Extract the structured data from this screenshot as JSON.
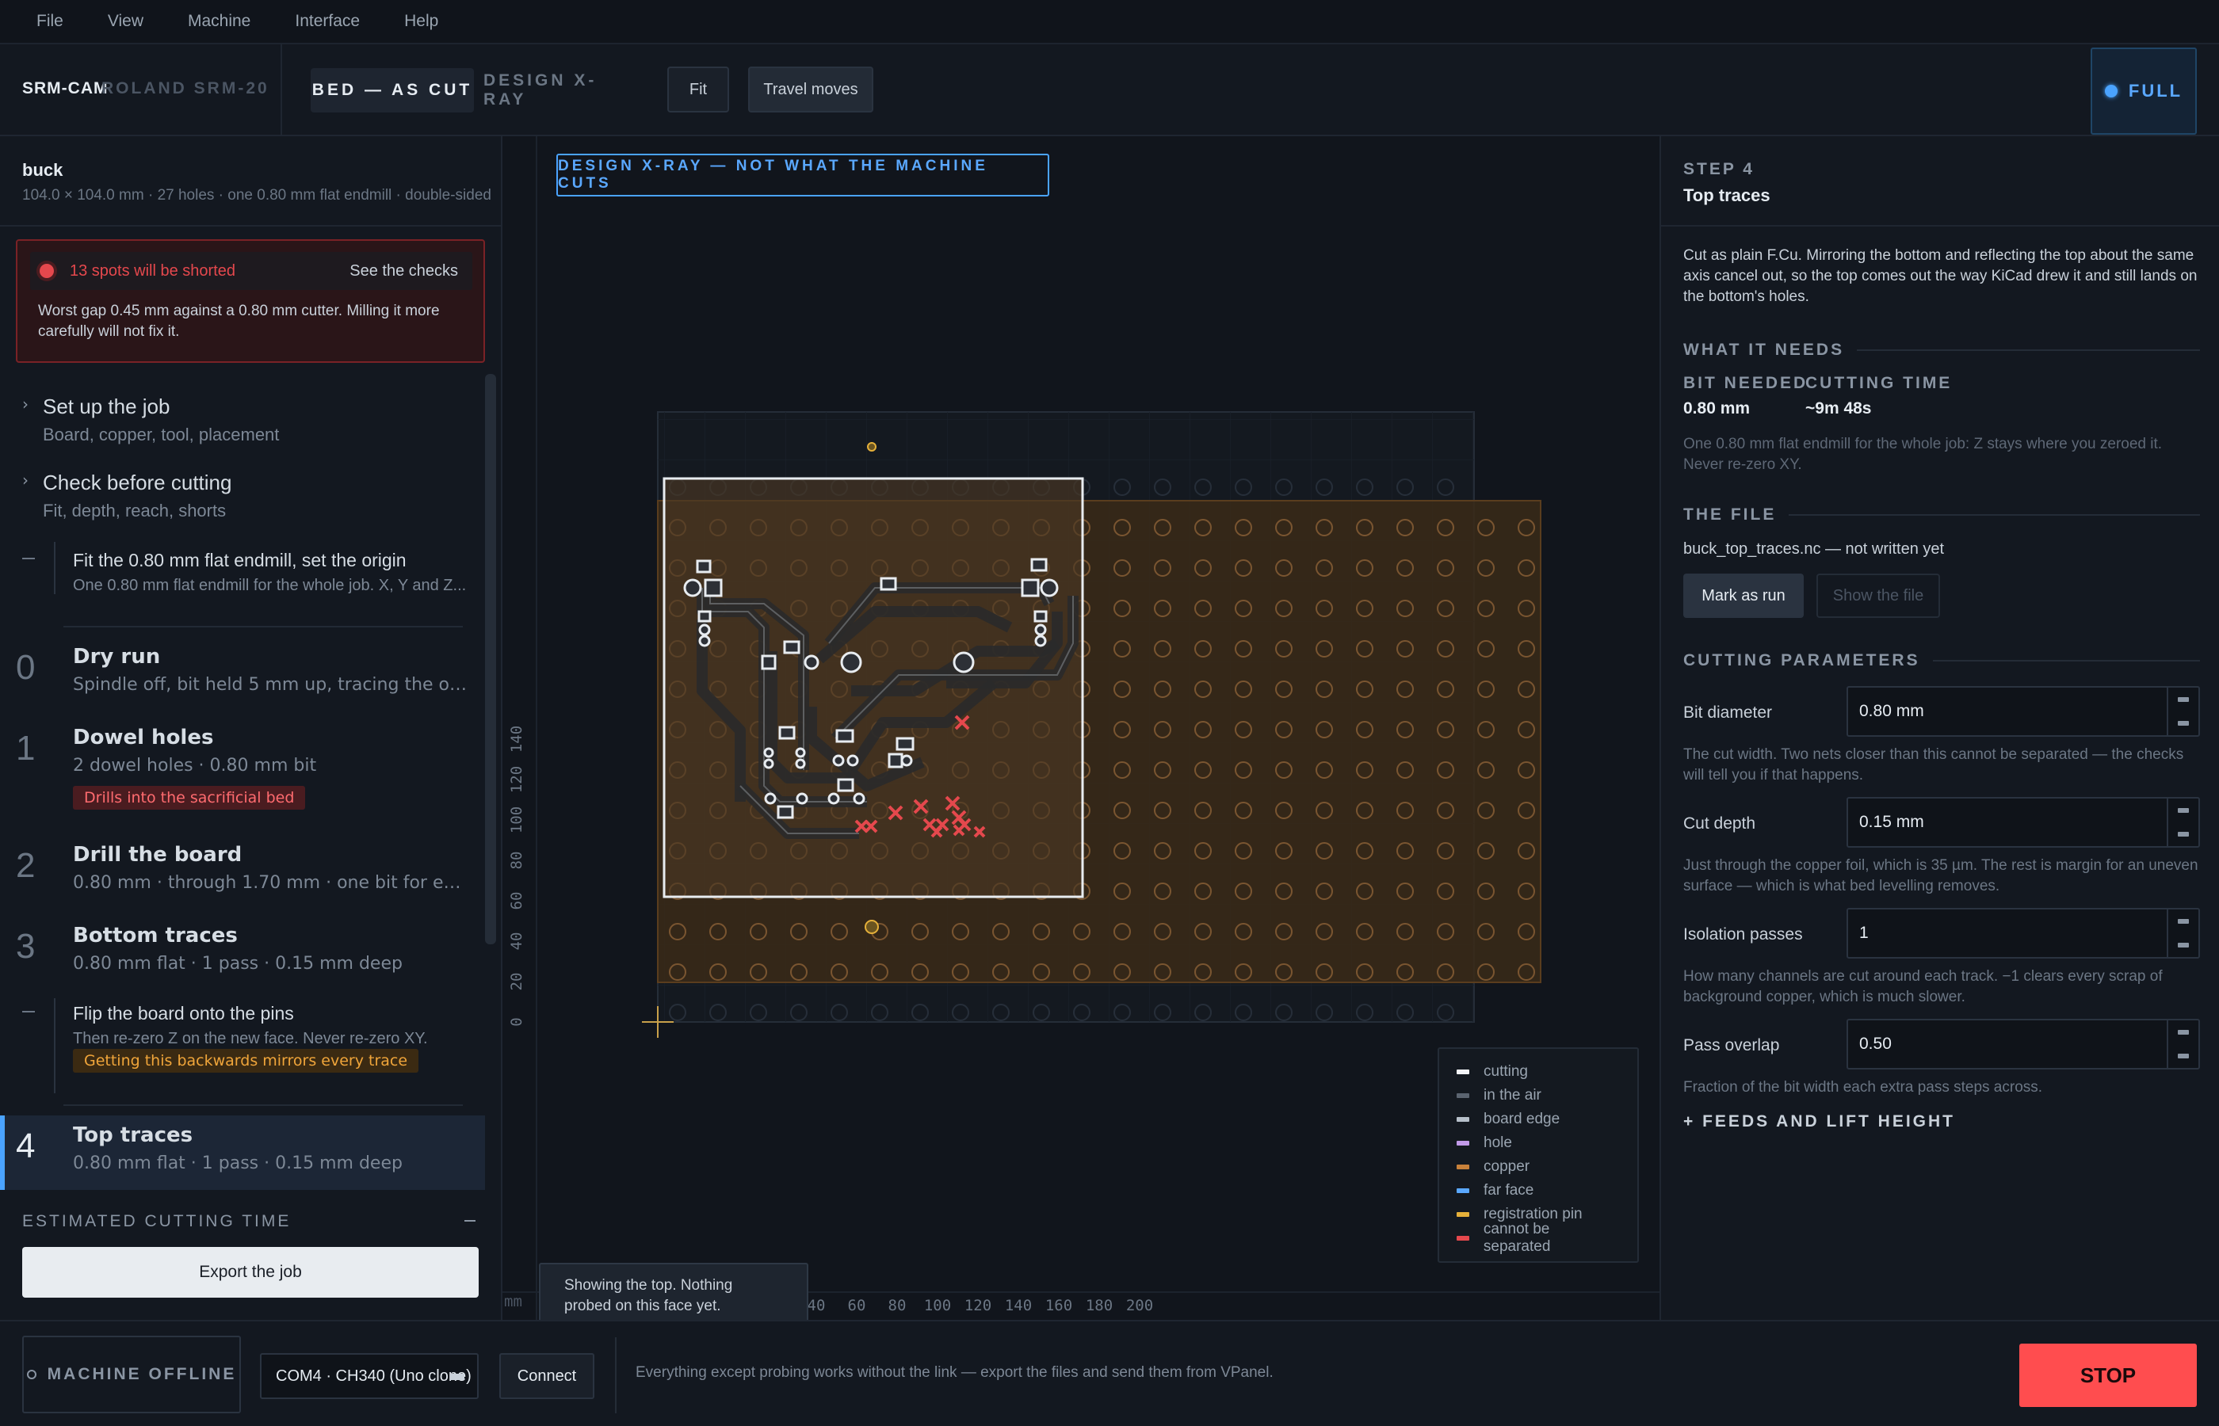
{
  "menu": [
    "File",
    "View",
    "Machine",
    "Interface",
    "Help"
  ],
  "toolbar": {
    "app_name": "SRM-CAM",
    "machine": "ROLAND SRM-20",
    "view_active": "BED — AS CUT",
    "view_inactive": "DESIGN X-RAY",
    "fit_label": "Fit",
    "travel_label": "Travel moves",
    "full_label": "FULL",
    "accent": "#4aa3ff"
  },
  "project": {
    "name": "buck",
    "meta": "104.0 × 104.0 mm · 27 holes · one 0.80 mm flat endmill · double-sided"
  },
  "alert": {
    "title": "13 spots will be shorted",
    "link": "See the checks",
    "body": "Worst gap 0.45 mm against a 0.80 mm cutter. Milling it more carefully will not fix it."
  },
  "stages": [
    {
      "title": "Set up the job",
      "sub": "Board, copper, tool, placement"
    },
    {
      "title": "Check before cutting",
      "sub": "Fit, depth, reach, shorts"
    }
  ],
  "origin_step": {
    "title": "Fit the 0.80 mm flat endmill, set the origin",
    "sub": "One 0.80 mm flat endmill for the whole job. X, Y and Z..."
  },
  "steps": [
    {
      "num": "0",
      "title": "Dry run",
      "sub": "Spindle off, bit held 5 mm up, tracing the out..."
    },
    {
      "num": "1",
      "title": "Dowel holes",
      "sub": "2 dowel holes · 0.80 mm bit",
      "tag": "Drills into the sacrificial bed"
    },
    {
      "num": "2",
      "title": "Drill the board",
      "sub": "0.80 mm · through 1.70 mm · one bit for every..."
    },
    {
      "num": "3",
      "title": "Bottom traces",
      "sub": "0.80 mm flat · 1 pass · 0.15 mm deep"
    },
    {
      "num": "4",
      "title": "Top traces",
      "sub": "0.80 mm flat · 1 pass · 0.15 mm deep"
    }
  ],
  "flip_step": {
    "title": "Flip the board onto the pins",
    "sub": "Then re-zero Z on the new face. Never re-zero XY.",
    "tag": "Getting this backwards mirrors every trace"
  },
  "estimate": {
    "title": "ESTIMATED CUTTING TIME",
    "export_label": "Export the job"
  },
  "canvas": {
    "xray_badge": "DESIGN X-RAY — NOT WHAT THE MACHINE CUTS",
    "units": "mm",
    "y_ticks": [
      "0",
      "20",
      "40",
      "60",
      "80",
      "100",
      "120",
      "140"
    ],
    "x_ticks": [
      "40",
      "60",
      "80",
      "100",
      "120",
      "140",
      "160",
      "180",
      "200"
    ],
    "tooltip": "Showing the top. Nothing probed on this face yet.",
    "legend": [
      {
        "label": "cutting",
        "color": "#f2f4f7"
      },
      {
        "label": "in the air",
        "color": "#5b6470"
      },
      {
        "label": "board edge",
        "color": "#b7c0ca"
      },
      {
        "label": "hole",
        "color": "#c29ae8"
      },
      {
        "label": "copper",
        "color": "#c8813a"
      },
      {
        "label": "far face",
        "color": "#5aa8ff"
      },
      {
        "label": "registration pin",
        "color": "#e5b03a"
      },
      {
        "label": "cannot be separated",
        "color": "#e5484d"
      }
    ]
  },
  "inspector": {
    "step_label": "STEP 4",
    "title": "Top traces",
    "desc": "Cut as plain F.Cu. Mirroring the bottom and reflecting the top about the same axis cancel out, so the top comes out the way KiCad drew it and still lands on the bottom's holes.",
    "needs_title": "WHAT IT NEEDS",
    "bit_key": "BIT NEEDED",
    "bit_val": "0.80 mm",
    "time_key": "CUTTING TIME",
    "time_val": "~9m 48s",
    "needs_note": "One 0.80 mm flat endmill for the whole job: Z stays where you zeroed it. Never re-zero XY.",
    "file_title": "THE FILE",
    "file_name": "buck_top_traces.nc — not written yet",
    "mark_run": "Mark as run",
    "show_file": "Show the file",
    "params_title": "CUTTING PARAMETERS",
    "params": [
      {
        "label": "Bit diameter",
        "value": "0.80 mm",
        "help": "The cut width. Two nets closer than this cannot be separated — the checks will tell you if that happens."
      },
      {
        "label": "Cut depth",
        "value": "0.15 mm",
        "help": "Just through the copper foil, which is 35 µm. The rest is margin for an uneven surface — which is what bed levelling removes."
      },
      {
        "label": "Isolation passes",
        "value": "1",
        "help": "How many channels are cut around each track. −1 clears every scrap of background copper, which is much slower."
      },
      {
        "label": "Pass overlap",
        "value": "0.50",
        "help": "Fraction of the bit width each extra pass steps across."
      }
    ],
    "feeds_label": "+  FEEDS AND LIFT HEIGHT"
  },
  "status": {
    "machine": "MACHINE OFFLINE",
    "port": "COM4 · CH340 (Uno clone)",
    "connect": "Connect",
    "message": "Everything except probing works without the link — export the files and send them from VPanel.",
    "stop": "STOP"
  }
}
